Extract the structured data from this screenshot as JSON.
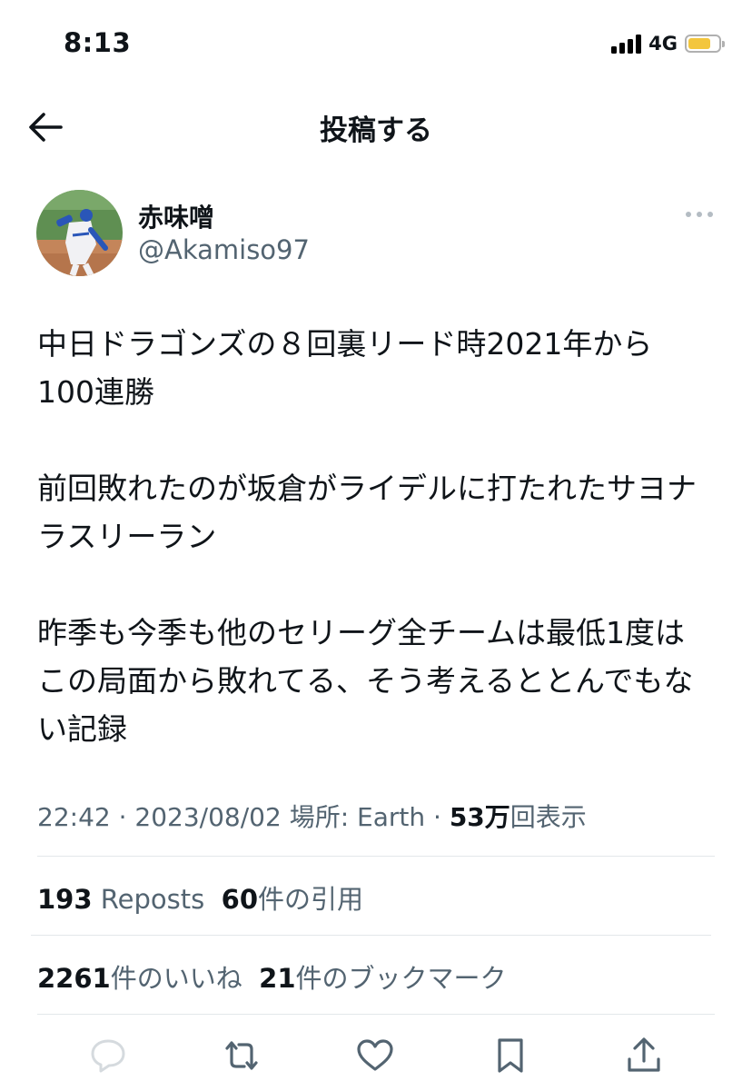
{
  "status_bar": {
    "time": "8:13",
    "network": "4G",
    "battery_level": 0.75
  },
  "header": {
    "title": "投稿する"
  },
  "author": {
    "display_name": "赤味噌",
    "handle": "@Akamiso97"
  },
  "tweet": {
    "text": "中日ドラゴンズの８回裏リード時2021年から\n100連勝\n\n前回敗れたのが坂倉がライデルに打たれたサヨナ\nラスリーラン\n\n昨季も今季も他のセリーグ全チームは最低1度は\nこの局面から敗れてる、そう考えるととんでもな\nい記録",
    "time": "22:42",
    "separator": " · ",
    "date": "2023/08/02",
    "location": "場所: Earth",
    "views_count": "53万",
    "views_label": "回表示"
  },
  "stats": {
    "reposts_count": "193",
    "reposts_label": "Reposts",
    "quotes_count": "60",
    "quotes_label": "件の引用",
    "likes_count": "2261",
    "likes_label": "件のいいね",
    "bookmarks_count": "21",
    "bookmarks_label": "件のブックマーク"
  },
  "actions": {
    "icons": [
      "reply-icon",
      "repost-icon",
      "like-icon",
      "bookmark-icon",
      "share-icon"
    ]
  },
  "colors": {
    "text": "#0f1419",
    "secondary": "#536471",
    "divider": "#e3e7ea",
    "battery": "#f3c63d"
  }
}
